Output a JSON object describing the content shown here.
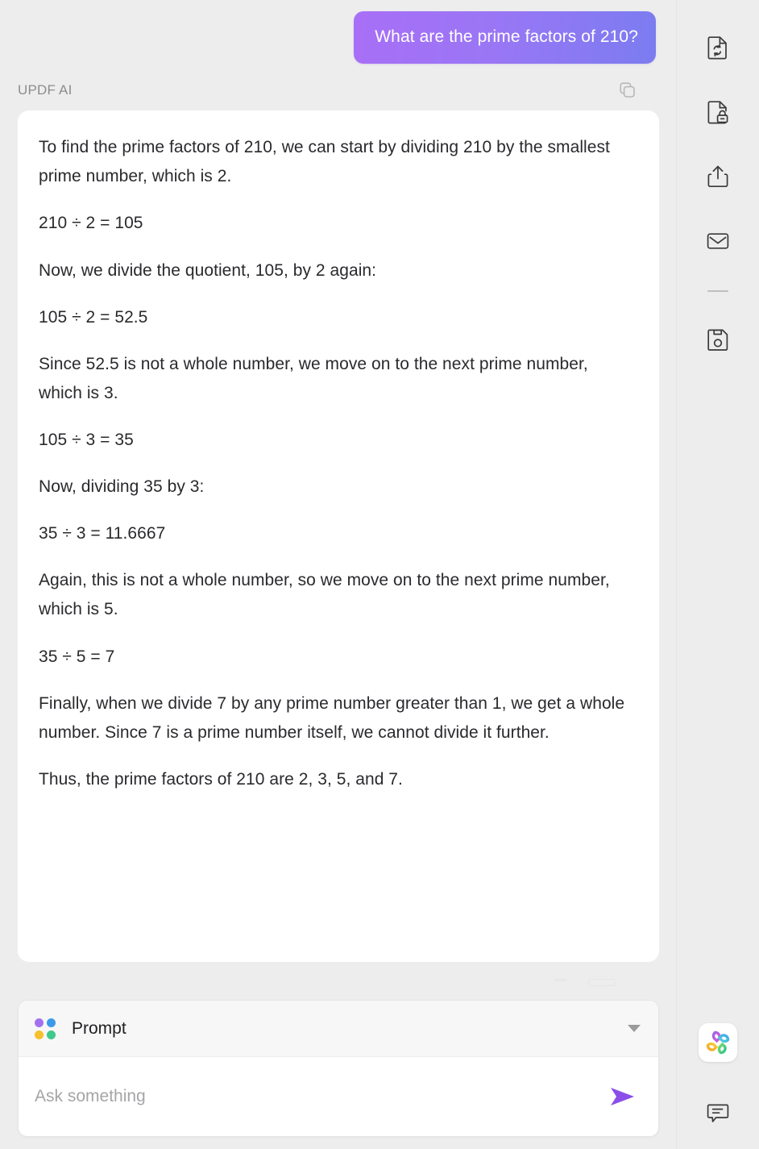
{
  "conversation": {
    "user_message": "What are the prime factors of 210?",
    "assistant_label": "UPDF AI",
    "copy_icon": "copy-icon",
    "answer_paragraphs": [
      "To find the prime factors of 210, we can start by dividing 210 by the smallest prime number, which is 2.",
      "210 ÷ 2 = 105",
      "Now, we divide the quotient, 105, by 2 again:",
      "105 ÷ 2 = 52.5",
      "Since 52.5 is not a whole number, we move on to the next prime number, which is 3.",
      "105 ÷ 3 = 35",
      "Now, dividing 35 by 3:",
      "35 ÷ 3 = 11.6667",
      "Again, this is not a whole number, so we move on to the next prime number, which is 5.",
      "35 ÷ 5 = 7",
      "Finally, when we divide 7 by any prime number greater than 1, we get a whole number. Since 7 is a prime number itself, we cannot divide it further.",
      "Thus, the prime factors of 210 are 2, 3, 5, and 7."
    ]
  },
  "composer": {
    "prompt_label": "Prompt",
    "prompt_icon": "four-dots-icon",
    "dropdown_icon": "chevron-down-icon",
    "input_placeholder": "Ask something",
    "input_value": "",
    "send_icon": "send-icon"
  },
  "toolbar": {
    "items": [
      {
        "name": "convert-document-icon",
        "label": "Convert PDF"
      },
      {
        "name": "protect-document-icon",
        "label": "Protect PDF"
      },
      {
        "name": "share-icon",
        "label": "Share"
      },
      {
        "name": "mail-icon",
        "label": "Email"
      }
    ],
    "separator": "toolbar-separator",
    "save_item": {
      "name": "save-icon",
      "label": "Save"
    },
    "ai_logo": {
      "name": "updf-ai-logo-icon",
      "label": "UPDF AI"
    },
    "comment_item": {
      "name": "comment-icon",
      "label": "Comment"
    }
  },
  "colors": {
    "bubble_gradient_start": "#a86ff6",
    "bubble_gradient_end": "#7b7cf0",
    "send_arrow": "#8b4ee8",
    "page_background": "#ededed",
    "card_background": "#ffffff",
    "assistant_label": "#8d8d8f",
    "dot_purple": "#a371f0",
    "dot_blue": "#3c9ae8",
    "dot_yellow": "#f5c02b",
    "dot_green": "#3fc98a"
  }
}
